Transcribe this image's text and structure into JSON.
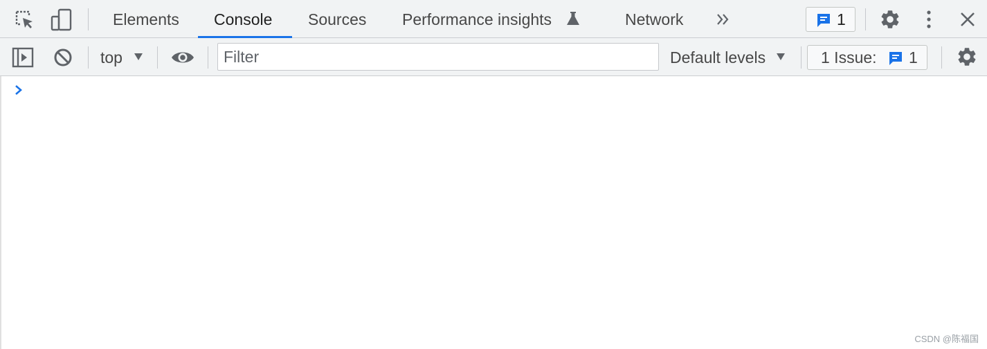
{
  "tabs": [
    {
      "label": "Elements"
    },
    {
      "label": "Console"
    },
    {
      "label": "Sources"
    },
    {
      "label": "Performance insights"
    },
    {
      "label": "Network"
    }
  ],
  "active_tab": "Console",
  "tabbar": {
    "issues_badge_count": "1"
  },
  "console_toolbar": {
    "context": "top",
    "filter_placeholder": "Filter",
    "levels": "Default levels",
    "issues_label": "1 Issue:",
    "issues_count": "1"
  },
  "watermark": "CSDN @陈福国",
  "colors": {
    "accent": "#1a73e8",
    "toolbar_bg": "#f1f3f4",
    "icon": "#5f6368"
  },
  "icons": [
    "inspect-element-icon",
    "device-toolbar-icon",
    "more-tabs-icon",
    "issues-icon",
    "settings-icon",
    "more-options-icon",
    "close-icon",
    "sidebar-toggle-icon",
    "clear-console-icon",
    "dropdown-arrow-icon",
    "live-expression-icon",
    "console-settings-icon",
    "console-prompt-icon"
  ]
}
